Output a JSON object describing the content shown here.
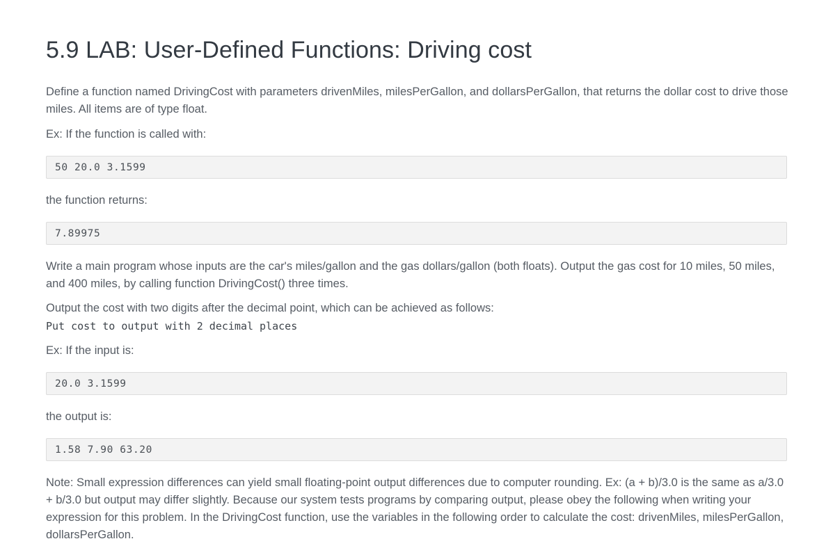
{
  "lab": {
    "title": "5.9 LAB: User-Defined Functions: Driving cost",
    "intro": "Define a function named DrivingCost with parameters drivenMiles, milesPerGallon, and dollarsPerGallon, that returns the dollar cost to drive those miles. All items are of type float.",
    "example_call_label": "Ex: If the function is called with:",
    "example_call_code": "50 20.0 3.1599",
    "returns_label": "the function returns:",
    "returns_code": "7.89975",
    "main_program_text": "Write a main program whose inputs are the car's miles/gallon and the gas dollars/gallon (both floats). Output the gas cost for 10 miles, 50 miles, and 400 miles, by calling function DrivingCost() three times.",
    "output_format_text": "Output the cost with two digits after the decimal point, which can be achieved as follows:",
    "output_format_code": "Put cost to output with 2 decimal places",
    "example_input_label": "Ex: If the input is:",
    "example_input_code": "20.0 3.1599",
    "output_label": "the output is:",
    "output_code": "1.58 7.90 63.20",
    "note_text": "Note: Small expression differences can yield small floating-point output differences due to computer rounding. Ex: (a + b)/3.0 is the same as a/3.0 + b/3.0 but output may differ slightly. Because our system tests programs by comparing output, please obey the following when writing your expression for this problem. In the DrivingCost function, use the variables in the following order to calculate the cost: drivenMiles, milesPerGallon, dollarsPerGallon."
  }
}
